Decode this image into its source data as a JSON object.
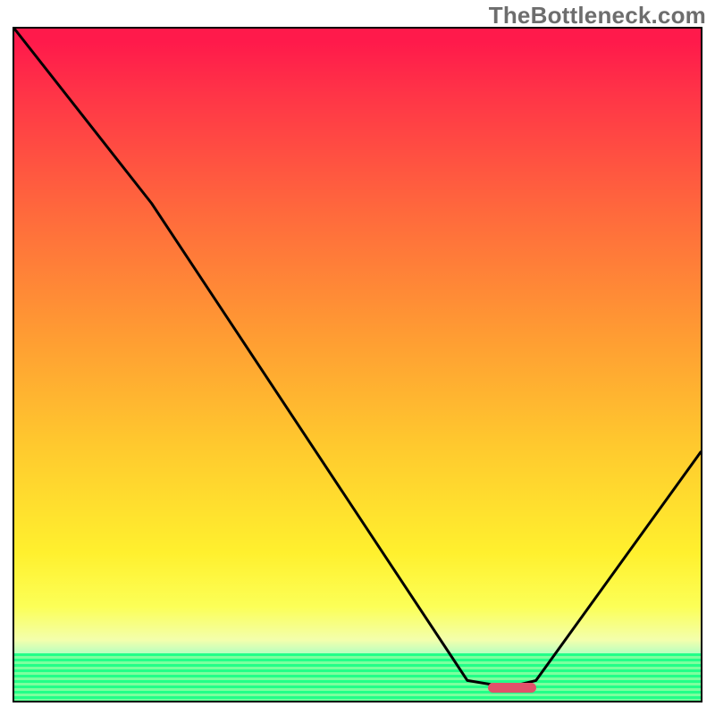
{
  "watermark": "TheBottleneck.com",
  "chart_data": {
    "type": "line",
    "title": "",
    "xlabel": "",
    "ylabel": "",
    "xlim": [
      0,
      100
    ],
    "ylim": [
      0,
      100
    ],
    "grid": false,
    "legend": false,
    "series": [
      {
        "name": "bottleneck-curve",
        "x": [
          0,
          20,
          66,
          72,
          76,
          100
        ],
        "values": [
          100,
          74,
          3,
          2,
          3,
          37
        ]
      }
    ],
    "marker": {
      "name": "optimal-range",
      "x_start": 69,
      "x_end": 76,
      "y": 2,
      "color": "#e2516a"
    },
    "background": {
      "type": "vertical-gradient",
      "stops": [
        {
          "pos": 0.0,
          "color": "#ff1a4b"
        },
        {
          "pos": 0.28,
          "color": "#ff6b3c"
        },
        {
          "pos": 0.62,
          "color": "#ffc92e"
        },
        {
          "pos": 0.86,
          "color": "#fcff57"
        },
        {
          "pos": 0.93,
          "color": "#b6ffc0"
        },
        {
          "pos": 1.0,
          "color": "#1aff77"
        }
      ],
      "bottom_stripes": {
        "from": 0.93,
        "to": 1.0,
        "colors": [
          "#22ff88",
          "#7cff9e"
        ]
      }
    }
  }
}
